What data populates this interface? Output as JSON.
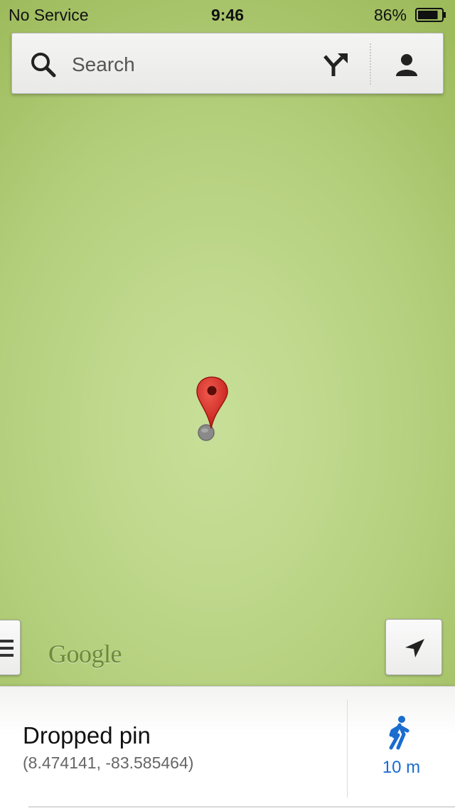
{
  "status_bar": {
    "carrier": "No Service",
    "time": "9:46",
    "battery": "86%",
    "battery_level": 0.86
  },
  "search": {
    "placeholder": "Search",
    "icons": {
      "search": "search-icon",
      "directions": "directions-icon",
      "account": "account-icon"
    }
  },
  "map": {
    "logo": "Google",
    "pin": "red-map-pin-icon",
    "colors": {
      "map_green": "#bfd88c",
      "pin_red": "#d62a22"
    }
  },
  "controls": {
    "menu_icon": "menu-icon",
    "location_icon": "location-arrow-icon"
  },
  "place": {
    "title": "Dropped pin",
    "coordinates": "(8.474141, -83.585464)",
    "walk_distance": "10 m",
    "walk_icon": "walking-person-icon",
    "accent": "#1a6ccf"
  }
}
